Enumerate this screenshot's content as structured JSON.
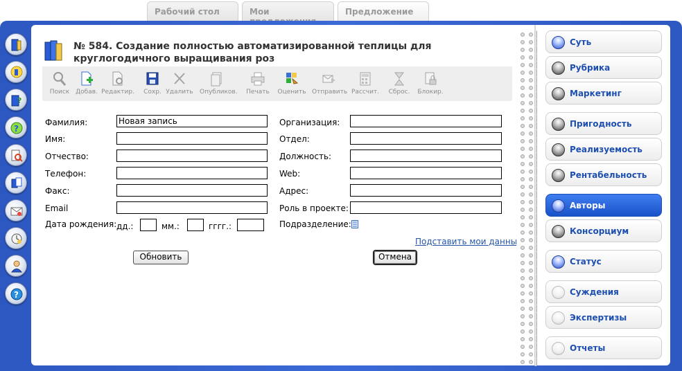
{
  "top_tabs": [
    {
      "label": "Рабочий стол"
    },
    {
      "label": "Мои предложения"
    },
    {
      "label": "Предложение"
    }
  ],
  "left_icons": [
    "book-icon",
    "lightbulb-icon",
    "book-question-icon",
    "help-chat-icon",
    "document-search-icon",
    "copy-documents-icon",
    "mail-icon",
    "clock-icon",
    "user-icon",
    "help-icon"
  ],
  "document": {
    "title": "№ 584. Создание полностью автоматизированной теплицы для круглогодичного выращивания роз"
  },
  "toolbar": {
    "search": "Поиск",
    "add": "Добав.",
    "edit": "Редактир.",
    "save": "Сохр.",
    "delete": "Удалить",
    "publish": "Опубликов.",
    "print": "Печать",
    "rate": "Оценить",
    "send": "Отправить",
    "calc": "Рассчит.",
    "reset": "Сброс.",
    "block": "Блокир."
  },
  "form": {
    "last_name_label": "Фамилия:",
    "last_name_value": "Новая запись",
    "first_name_label": "Имя:",
    "first_name_value": "",
    "middle_name_label": "Отчество:",
    "middle_name_value": "",
    "phone_label": "Телефон:",
    "phone_value": "",
    "fax_label": "Факс:",
    "fax_value": "",
    "email_label": "Email",
    "email_value": "",
    "birthdate_label": "Дата рождения:",
    "day_label": "дд.:",
    "month_label": "мм.:",
    "year_label": "гггг.:",
    "org_label": "Организация:",
    "org_value": "",
    "dept_label": "Отдел:",
    "dept_value": "",
    "position_label": "Должность:",
    "position_value": "",
    "web_label": "Web:",
    "web_value": "",
    "address_label": "Адрес:",
    "address_value": "",
    "role_label": "Роль в проекте:",
    "role_value": "",
    "subdivision_label": "Подразделение:",
    "fill_my_data_link": "Подставить мои данные",
    "update_button": "Обновить",
    "cancel_button": "Отмена"
  },
  "right_nav": [
    {
      "label": "Суть",
      "state": "blue"
    },
    {
      "label": "Рубрика",
      "state": "dark"
    },
    {
      "label": "Маркетинг",
      "state": "dark"
    },
    {
      "label": "Пригодность",
      "state": "dark"
    },
    {
      "label": "Реализуемость",
      "state": "dark"
    },
    {
      "label": "Рентабельность",
      "state": "dark"
    },
    {
      "label": "Авторы",
      "state": "active"
    },
    {
      "label": "Консорциум",
      "state": "dark"
    },
    {
      "label": "Статус",
      "state": "blue"
    },
    {
      "label": "Суждения",
      "state": "light"
    },
    {
      "label": "Экспертизы",
      "state": "light"
    },
    {
      "label": "Отчеты",
      "state": "light"
    }
  ],
  "colors": {
    "frame_blue": "#3b6ad6",
    "nav_text": "#1d4fb0",
    "active_nav": "#2a63dd",
    "toolbar_bg": "#eeeeee"
  }
}
